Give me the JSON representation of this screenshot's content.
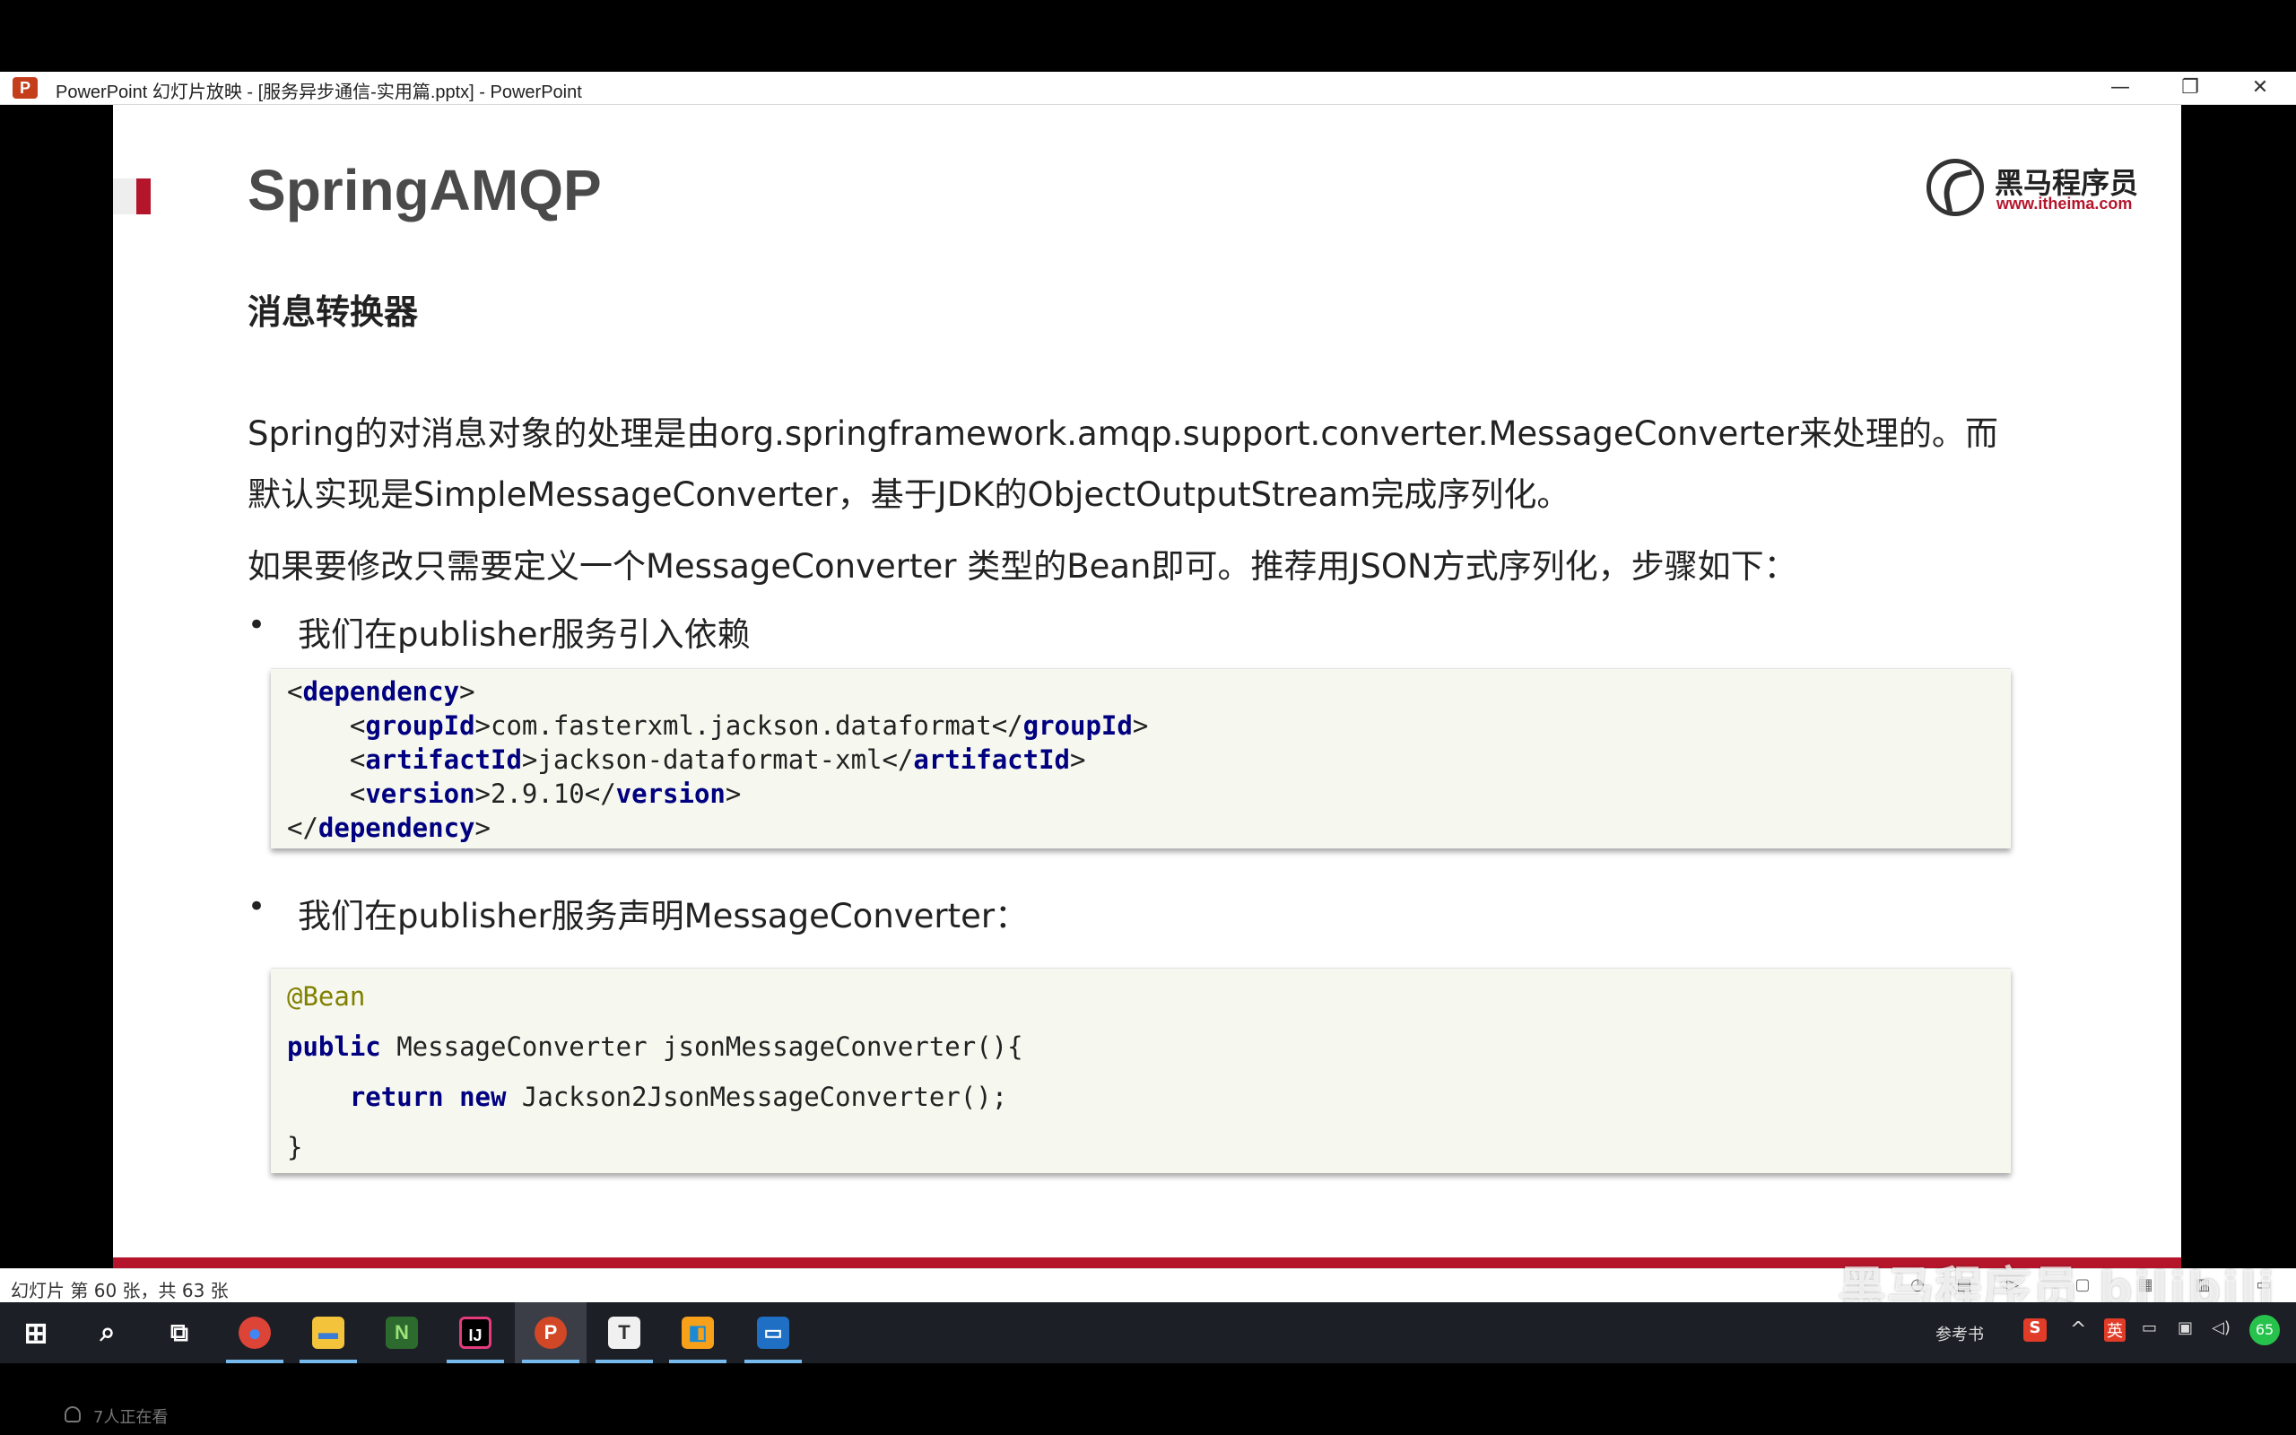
{
  "window": {
    "app_icon_letter": "P",
    "title": "PowerPoint 幻灯片放映 - [服务异步通信-实用篇.pptx] - PowerPoint",
    "minimize": "—",
    "restore": "❐",
    "close": "✕"
  },
  "slide": {
    "title": "SpringAMQP",
    "brand_name": "黑马程序员",
    "brand_url": "www.itheima.com",
    "section_heading": "消息转换器",
    "paragraph_line1": "Spring的对消息对象的处理是由org.springframework.amqp.support.converter.MessageConverter来处理的。而",
    "paragraph_line2": "默认实现是SimpleMessageConverter，基于JDK的ObjectOutputStream完成序列化。",
    "paragraph2": "如果要修改只需要定义一个MessageConverter 类型的Bean即可。推荐用JSON方式序列化，步骤如下：",
    "bullet_char": "•",
    "bullet1": "我们在publisher服务引入依赖",
    "bullet2": "我们在publisher服务声明MessageConverter：",
    "code1": {
      "l1_open": "<",
      "l1_tag": "dependency",
      "l1_close": ">",
      "l2_indent": "    <",
      "l2_tag": "groupId",
      "l2_mid": ">com.fasterxml.jackson.dataformat</",
      "l2_tag2": "groupId",
      "l2_end": ">",
      "l3_indent": "    <",
      "l3_tag": "artifactId",
      "l3_mid": ">jackson-dataformat-xml</",
      "l3_tag2": "artifactId",
      "l3_end": ">",
      "l4_indent": "    <",
      "l4_tag": "version",
      "l4_mid": ">2.9.10</",
      "l4_tag2": "version",
      "l4_end": ">",
      "l5_open": "</",
      "l5_tag": "dependency",
      "l5_close": ">"
    },
    "code2": {
      "annotation": "@Bean",
      "l2_kw": "public",
      "l2_rest": " MessageConverter jsonMessageConverter(){",
      "l3_indent": "    ",
      "l3_kw1": "return",
      "l3_sp": " ",
      "l3_kw2": "new",
      "l3_rest": " Jackson2JsonMessageConverter();",
      "l4": "}"
    }
  },
  "statusbar": {
    "slide_counter": "幻灯片 第 60 张，共 63 张",
    "watermark": "黑马程序员 bilibili"
  },
  "taskbar": {
    "apps": [
      {
        "name": "start",
        "label": "⊞"
      },
      {
        "name": "search",
        "label": "⌕"
      },
      {
        "name": "task-view",
        "label": "⧉"
      },
      {
        "name": "chrome",
        "label": "●"
      },
      {
        "name": "file-explorer",
        "label": "▬"
      },
      {
        "name": "notepad",
        "label": "N"
      },
      {
        "name": "intellij",
        "label": "IJ"
      },
      {
        "name": "powerpoint",
        "label": "P"
      },
      {
        "name": "typora",
        "label": "T"
      },
      {
        "name": "app-orange",
        "label": "◧"
      },
      {
        "name": "remote-desktop",
        "label": "▭"
      }
    ],
    "tray_label": "参考书",
    "tray_ime": "英",
    "tray_badge": "65",
    "tray_expand": "^"
  },
  "overlay": {
    "viewers": "7人正在看"
  },
  "colors": {
    "accent_red": "#b5152b",
    "code_bg": "#f6f8ef",
    "tag_blue": "#000080",
    "annotation_olive": "#808000",
    "taskbar_bg": "#1d1f26"
  }
}
